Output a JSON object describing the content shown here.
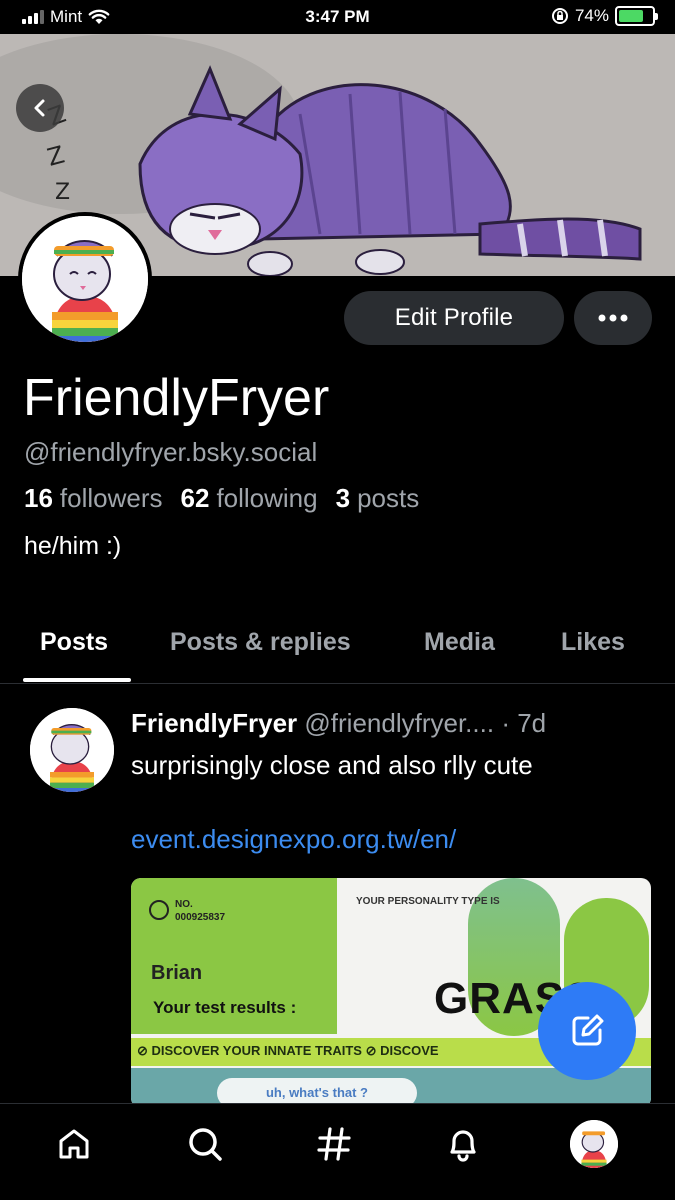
{
  "status_bar": {
    "carrier": "Mint",
    "time": "3:47 PM",
    "battery": "74%"
  },
  "profile": {
    "edit_label": "Edit Profile",
    "display_name": "FriendlyFryer",
    "handle": "@friendlyfryer.bsky.social",
    "stats": [
      {
        "count": "16",
        "label": "followers"
      },
      {
        "count": "62",
        "label": "following"
      },
      {
        "count": "3",
        "label": "posts"
      }
    ],
    "bio": "he/him :)"
  },
  "tabs": [
    {
      "label": "Posts",
      "active": true
    },
    {
      "label": "Posts & replies",
      "active": false
    },
    {
      "label": "Media",
      "active": false
    },
    {
      "label": "Likes",
      "active": false
    }
  ],
  "post": {
    "author": "FriendlyFryer",
    "handle": "@friendlyfryer....",
    "age": "· 7d",
    "text": "surprisingly close and also rlly cute",
    "link": "event.designexpo.org.tw/en/",
    "image": {
      "no_label": "NO.",
      "number": "000925837",
      "name": "Brian",
      "results_label": "Your test results :",
      "type_label": "YOUR PERSONALITY TYPE IS",
      "type_value": "GRASS",
      "strip_text": "DISCOVER YOUR INNATE TRAITS",
      "strip_text_2": "DISCOVE",
      "bubble_text": "uh, what's that ?"
    }
  },
  "nav": [
    {
      "icon": "home-icon"
    },
    {
      "icon": "search-icon"
    },
    {
      "icon": "hashtag-icon"
    },
    {
      "icon": "notifications-icon"
    },
    {
      "icon": "profile-avatar"
    }
  ],
  "colors": {
    "accent": "#2e7bf6",
    "link": "#3c8cf0",
    "muted": "#a0a5ab",
    "button_bg": "#2a2d31"
  }
}
